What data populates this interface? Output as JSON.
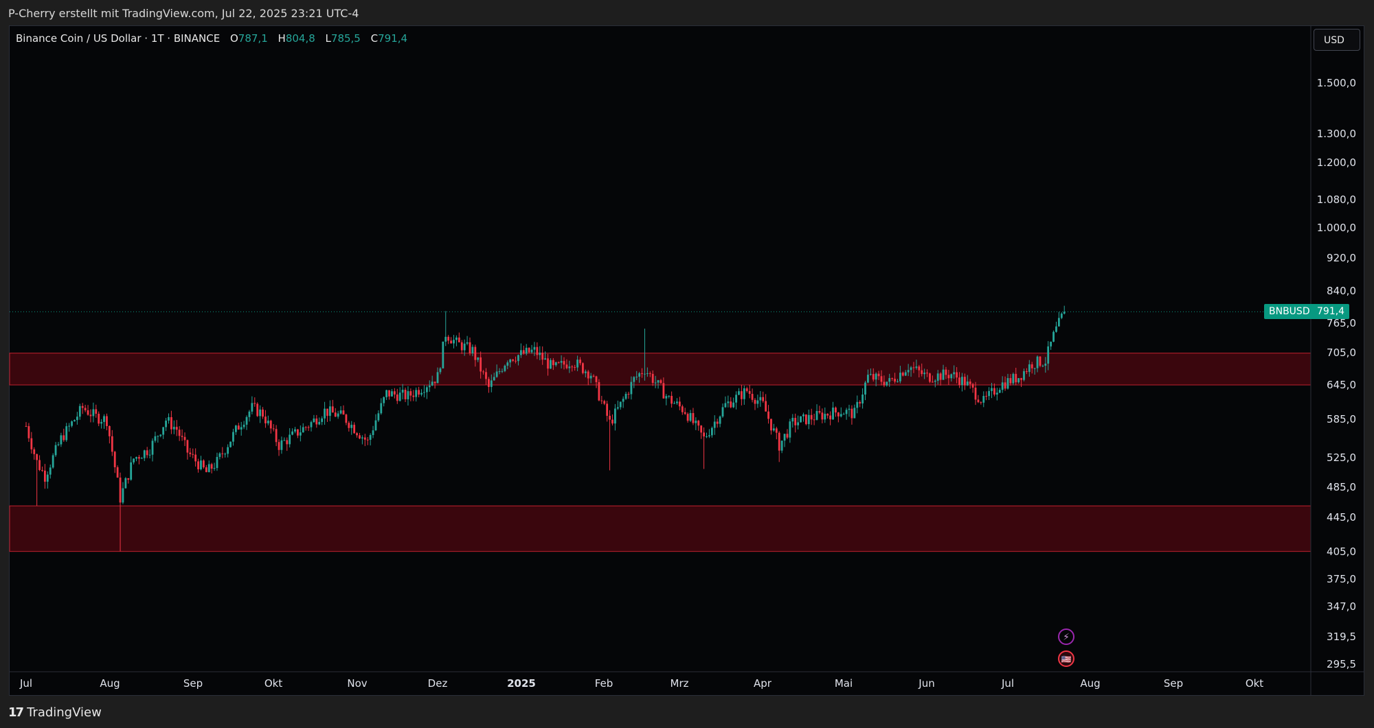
{
  "header": {
    "credit": "P-Cherry erstellt mit TradingView.com, Jul 22, 2025 23:21 UTC-4"
  },
  "legend": {
    "symbol_line": "Binance Coin / US Dollar · 1T · BINANCE",
    "o_label": "O",
    "o_value": "787,1",
    "h_label": "H",
    "h_value": "804,8",
    "l_label": "L",
    "l_value": "785,5",
    "c_label": "C",
    "c_value": "791,4"
  },
  "currency_button": "USD",
  "price_axis": [
    "1.500,0",
    "1.300,0",
    "1.200,0",
    "1.080,0",
    "1.000,0",
    "920,0",
    "840,0",
    "765,0",
    "705,0",
    "645,0",
    "585,0",
    "525,0",
    "485,0",
    "445,0",
    "405,0",
    "375,0",
    "347,0",
    "319,5",
    "295,5"
  ],
  "time_axis": [
    {
      "label": "Jul",
      "bold": false
    },
    {
      "label": "Aug",
      "bold": false
    },
    {
      "label": "Sep",
      "bold": false
    },
    {
      "label": "Okt",
      "bold": false
    },
    {
      "label": "Nov",
      "bold": false
    },
    {
      "label": "Dez",
      "bold": false
    },
    {
      "label": "2025",
      "bold": true
    },
    {
      "label": "Feb",
      "bold": false
    },
    {
      "label": "Mrz",
      "bold": false
    },
    {
      "label": "Apr",
      "bold": false
    },
    {
      "label": "Mai",
      "bold": false
    },
    {
      "label": "Jun",
      "bold": false
    },
    {
      "label": "Jul",
      "bold": false
    },
    {
      "label": "Aug",
      "bold": false
    },
    {
      "label": "Sep",
      "bold": false
    },
    {
      "label": "Okt",
      "bold": false
    }
  ],
  "last_price": {
    "symbol": "BNBUSD",
    "value": "791,4"
  },
  "footer": {
    "brand": "TradingView",
    "brand_mark": "17"
  },
  "colors": {
    "up": "#26a69a",
    "down": "#f23645",
    "zone_fill": "#3a060d",
    "zone_border": "#c0202e",
    "background": "#050608",
    "badge": "#089981"
  },
  "zones": [
    {
      "label": "resistance-zone",
      "from": 645,
      "to": 705
    },
    {
      "label": "support-zone",
      "from": 405,
      "to": 460
    }
  ],
  "chart_data": {
    "type": "candlestick",
    "scale": "log",
    "symbol": "BNBUSD",
    "interval": "1D",
    "ylim": [
      290,
      1700
    ],
    "x_ticks": [
      "Jul",
      "Aug",
      "Sep",
      "Okt",
      "Nov",
      "Dez",
      "2025",
      "Feb",
      "Mrz",
      "Apr",
      "Mai",
      "Jun",
      "Jul",
      "Aug",
      "Sep",
      "Okt"
    ],
    "anchors": [
      [
        "2024-07-01",
        575
      ],
      [
        "2024-07-05",
        520
      ],
      [
        "2024-07-08",
        500
      ],
      [
        "2024-07-14",
        555
      ],
      [
        "2024-07-22",
        605
      ],
      [
        "2024-07-27",
        590
      ],
      [
        "2024-07-31",
        585
      ],
      [
        "2024-08-05",
        470
      ],
      [
        "2024-08-10",
        525
      ],
      [
        "2024-08-16",
        540
      ],
      [
        "2024-08-22",
        585
      ],
      [
        "2024-08-26",
        570
      ],
      [
        "2024-08-30",
        535
      ],
      [
        "2024-09-06",
        505
      ],
      [
        "2024-09-10",
        520
      ],
      [
        "2024-09-18",
        575
      ],
      [
        "2024-09-23",
        605
      ],
      [
        "2024-09-27",
        595
      ],
      [
        "2024-10-03",
        545
      ],
      [
        "2024-10-10",
        565
      ],
      [
        "2024-10-15",
        580
      ],
      [
        "2024-10-20",
        600
      ],
      [
        "2024-10-27",
        590
      ],
      [
        "2024-11-05",
        550
      ],
      [
        "2024-11-08",
        585
      ],
      [
        "2024-11-12",
        630
      ],
      [
        "2024-11-20",
        625
      ],
      [
        "2024-11-25",
        640
      ],
      [
        "2024-12-01",
        660
      ],
      [
        "2024-12-04",
        745
      ],
      [
        "2024-12-08",
        725
      ],
      [
        "2024-12-14",
        710
      ],
      [
        "2024-12-20",
        640
      ],
      [
        "2024-12-27",
        695
      ],
      [
        "2025-01-06",
        710
      ],
      [
        "2025-01-13",
        675
      ],
      [
        "2025-01-20",
        690
      ],
      [
        "2025-01-27",
        665
      ],
      [
        "2025-02-03",
        580
      ],
      [
        "2025-02-07",
        610
      ],
      [
        "2025-02-12",
        655
      ],
      [
        "2025-02-16",
        675
      ],
      [
        "2025-02-25",
        620
      ],
      [
        "2025-03-03",
        600
      ],
      [
        "2025-03-10",
        555
      ],
      [
        "2025-03-18",
        610
      ],
      [
        "2025-03-26",
        635
      ],
      [
        "2025-04-01",
        610
      ],
      [
        "2025-04-07",
        545
      ],
      [
        "2025-04-12",
        580
      ],
      [
        "2025-04-20",
        590
      ],
      [
        "2025-04-30",
        600
      ],
      [
        "2025-05-05",
        595
      ],
      [
        "2025-05-10",
        660
      ],
      [
        "2025-05-18",
        650
      ],
      [
        "2025-05-25",
        680
      ],
      [
        "2025-06-01",
        660
      ],
      [
        "2025-06-10",
        665
      ],
      [
        "2025-06-15",
        650
      ],
      [
        "2025-06-22",
        615
      ],
      [
        "2025-06-28",
        645
      ],
      [
        "2025-07-05",
        660
      ],
      [
        "2025-07-10",
        685
      ],
      [
        "2025-07-15",
        690
      ],
      [
        "2025-07-18",
        740
      ],
      [
        "2025-07-22",
        791.4
      ]
    ],
    "notable": {
      "high_dec": 793,
      "low_aug": 405,
      "low_feb": 508,
      "low_mar": 510,
      "last_close": 791.4
    }
  }
}
